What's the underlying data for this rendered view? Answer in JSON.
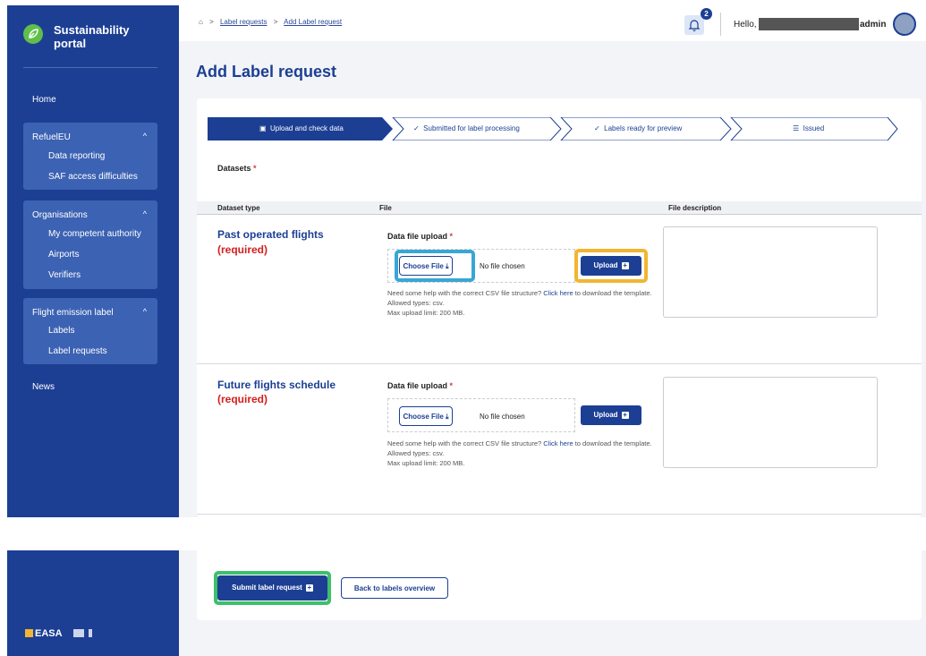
{
  "brand": {
    "name": "Sustainability portal",
    "accent": "#1c3f94",
    "sidebar_group_bg": "#3c62b3",
    "required_color": "#d21e1e"
  },
  "sidebar": {
    "home": "Home",
    "groups": [
      {
        "label": "RefuelEU",
        "items": [
          "Data reporting",
          "SAF access difficulties"
        ]
      },
      {
        "label": "Organisations",
        "items": [
          "My competent authority",
          "Airports",
          "Verifiers"
        ]
      },
      {
        "label": "Flight emission label",
        "items": [
          "Labels",
          "Label requests"
        ]
      }
    ],
    "news": "News",
    "footer_logo": "EASA"
  },
  "header": {
    "breadcrumb": [
      "Label requests",
      "Add Label request"
    ],
    "notification_count": "2",
    "greeting": "Hello,",
    "user_role": "admin"
  },
  "page": {
    "title": "Add Label request"
  },
  "stepper": {
    "steps": [
      {
        "label": "Upload and check data",
        "active": true
      },
      {
        "label": "Submitted for label processing",
        "active": false
      },
      {
        "label": "Labels ready for preview",
        "active": false
      },
      {
        "label": "Issued",
        "active": false
      }
    ]
  },
  "datasets": {
    "label": "Datasets",
    "required_mark": "*",
    "columns": [
      "Dataset type",
      "File",
      "File description"
    ],
    "rows": [
      {
        "title": "Past operated flights",
        "required": "(required)",
        "upload_label": "Data file upload",
        "choose_label": "Choose File",
        "no_file": "No file chosen",
        "upload_button": "Upload",
        "help_prefix": "Need some help with the correct CSV file structure?",
        "help_link": "Click here",
        "help_suffix": "to download the template.",
        "allowed": "Allowed types: csv.",
        "max": "Max upload limit: 200 MB."
      },
      {
        "title": "Future flights schedule",
        "required": "(required)",
        "upload_label": "Data file upload",
        "choose_label": "Choose File",
        "no_file": "No file chosen",
        "upload_button": "Upload",
        "help_prefix": "Need some help with the correct CSV file structure?",
        "help_link": "Click here",
        "help_suffix": "to download the template.",
        "allowed": "Allowed types: csv.",
        "max": "Max upload limit: 200 MB."
      }
    ]
  },
  "actions": {
    "submit": "Submit label request",
    "back": "Back to labels overview"
  }
}
